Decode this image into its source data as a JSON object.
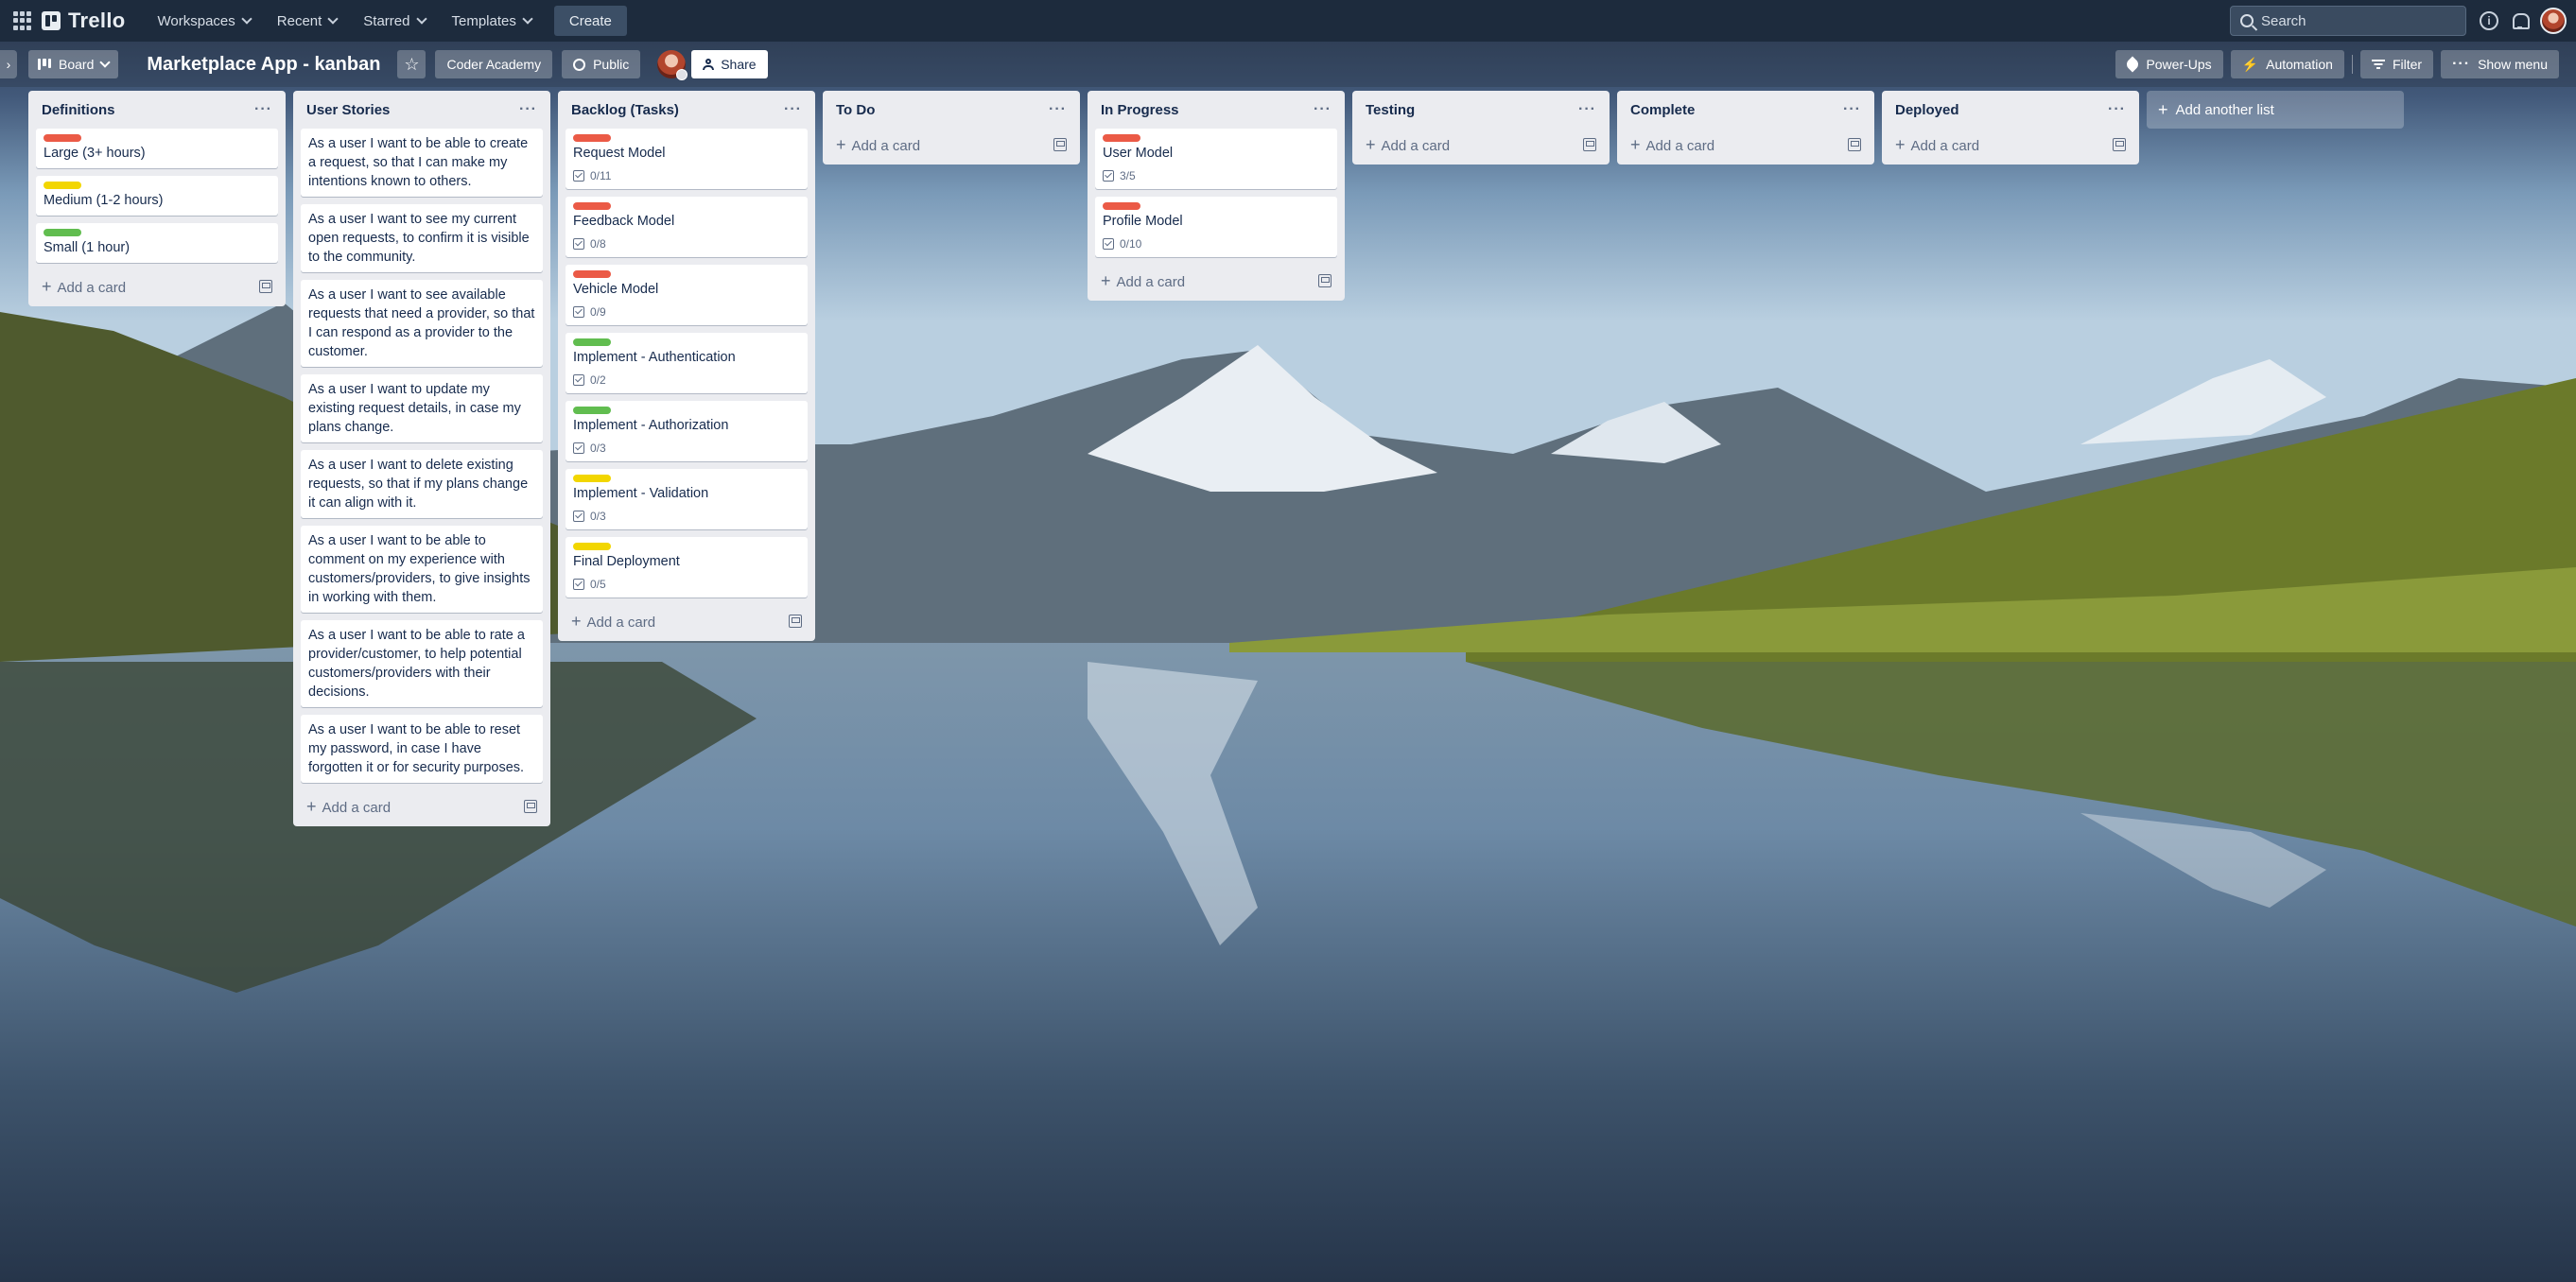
{
  "topbar": {
    "logo_text": "Trello",
    "nav": [
      {
        "label": "Workspaces"
      },
      {
        "label": "Recent"
      },
      {
        "label": "Starred"
      },
      {
        "label": "Templates"
      }
    ],
    "create_label": "Create",
    "search_placeholder": "Search",
    "icons": [
      "apps-grid-icon",
      "trello-logo-icon",
      "search-icon",
      "info-icon",
      "notifications-bell-icon",
      "user-avatar"
    ]
  },
  "board_header": {
    "view_label": "Board",
    "board_title": "Marketplace App - kanban",
    "workspace_label": "Coder Academy",
    "visibility_label": "Public",
    "share_label": "Share",
    "powerups_label": "Power-Ups",
    "automation_label": "Automation",
    "filter_label": "Filter",
    "show_menu_label": "Show menu"
  },
  "colors": {
    "label_red": "#eb5a46",
    "label_yellow": "#f2d600",
    "label_green": "#61bd4f",
    "topbar_bg": "#1d2b3d",
    "list_bg": "#ebecf0"
  },
  "lists": [
    {
      "title": "Definitions",
      "cards": [
        {
          "label": "red",
          "title": "Large (3+ hours)"
        },
        {
          "label": "yellow",
          "title": "Medium (1-2 hours)"
        },
        {
          "label": "green",
          "title": "Small (1 hour)"
        }
      ],
      "add_card_label": "Add a card"
    },
    {
      "title": "User Stories",
      "cards": [
        {
          "title": "As a user I want to be able to create a request, so that I can make my intentions known to others."
        },
        {
          "title": "As a user I want to see my current open requests, to confirm it is visible to the community."
        },
        {
          "title": "As a user I want to see available requests that need a provider, so that I can respond as a provider to the customer."
        },
        {
          "title": "As a user I want to update my existing request details, in case my plans change."
        },
        {
          "title": "As a user I want to delete existing requests, so that if my plans change it can align with it."
        },
        {
          "title": "As a user I want to be able to comment on my experience with customers/providers, to give insights in working with them."
        },
        {
          "title": "As a user I want to be able to rate a provider/customer, to help potential customers/providers with their decisions."
        },
        {
          "title": "As a user I want to be able to reset my password, in case I have forgotten it or for security purposes."
        }
      ],
      "add_card_label": "Add a card"
    },
    {
      "title": "Backlog (Tasks)",
      "cards": [
        {
          "label": "red",
          "title": "Request Model",
          "checklist": "0/11"
        },
        {
          "label": "red",
          "title": "Feedback Model",
          "checklist": "0/8"
        },
        {
          "label": "red",
          "title": "Vehicle Model",
          "checklist": "0/9"
        },
        {
          "label": "green",
          "title": "Implement - Authentication",
          "checklist": "0/2"
        },
        {
          "label": "green",
          "title": "Implement - Authorization",
          "checklist": "0/3"
        },
        {
          "label": "yellow",
          "title": "Implement - Validation",
          "checklist": "0/3"
        },
        {
          "label": "yellow",
          "title": "Final Deployment",
          "checklist": "0/5"
        }
      ],
      "add_card_label": "Add a card"
    },
    {
      "title": "To Do",
      "cards": [],
      "add_card_label": "Add a card"
    },
    {
      "title": "In Progress",
      "cards": [
        {
          "label": "red",
          "title": "User Model",
          "checklist": "3/5"
        },
        {
          "label": "red",
          "title": "Profile Model",
          "checklist": "0/10"
        }
      ],
      "add_card_label": "Add a card"
    },
    {
      "title": "Testing",
      "cards": [],
      "add_card_label": "Add a card"
    },
    {
      "title": "Complete",
      "cards": [],
      "add_card_label": "Add a card"
    },
    {
      "title": "Deployed",
      "cards": [],
      "add_card_label": "Add a card"
    }
  ],
  "add_list_label": "Add another list"
}
